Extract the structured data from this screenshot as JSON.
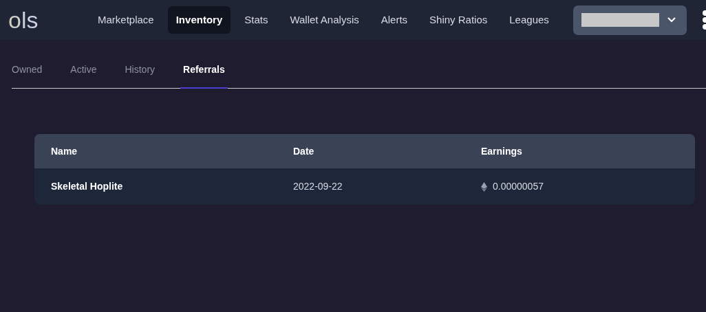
{
  "logo": {
    "text": "ols"
  },
  "nav": [
    {
      "label": "Marketplace",
      "selected": false
    },
    {
      "label": "Inventory",
      "selected": true
    },
    {
      "label": "Stats",
      "selected": false
    },
    {
      "label": "Wallet Analysis",
      "selected": false
    },
    {
      "label": "Alerts",
      "selected": false
    },
    {
      "label": "Shiny Ratios",
      "selected": false
    },
    {
      "label": "Leagues",
      "selected": false
    }
  ],
  "tabs": [
    {
      "label": "Owned",
      "selected": false
    },
    {
      "label": "Active",
      "selected": false
    },
    {
      "label": "History",
      "selected": false
    },
    {
      "label": "Referrals",
      "selected": true
    }
  ],
  "table": {
    "columns": [
      "Name",
      "Date",
      "Earnings"
    ],
    "rows": [
      {
        "name": "Skeletal Hoplite",
        "date": "2022-09-22",
        "earnings": "0.00000057"
      }
    ]
  }
}
